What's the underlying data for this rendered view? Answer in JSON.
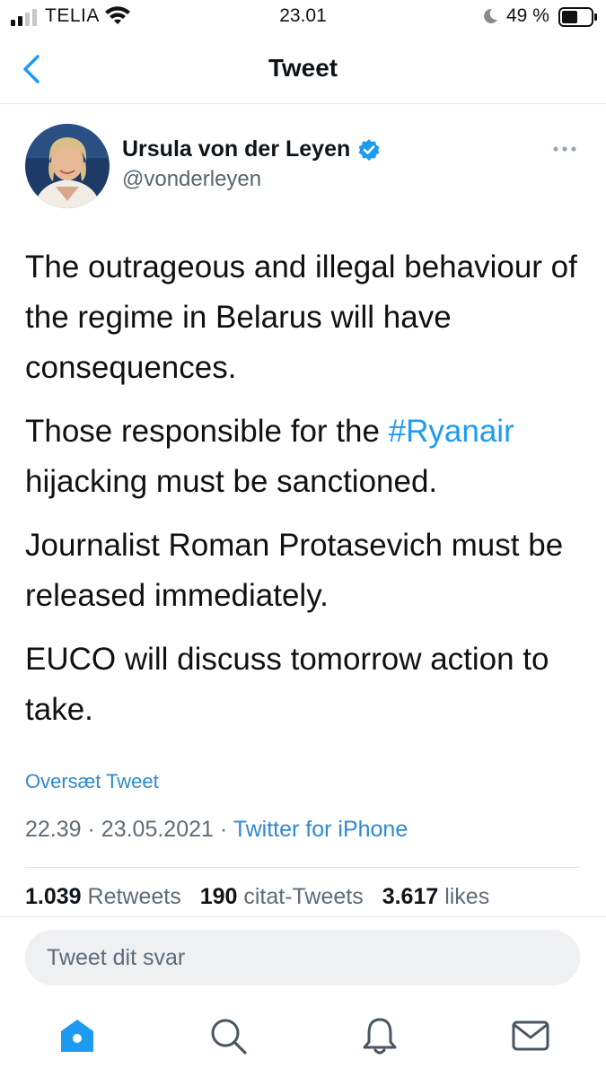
{
  "status_bar": {
    "carrier": "TELIA",
    "time": "23.01",
    "battery": "49 %",
    "icons": [
      "signal-icon",
      "wifi-icon",
      "moon-icon",
      "battery-icon"
    ]
  },
  "nav": {
    "title": "Tweet",
    "back_icon": "chevron-left-icon"
  },
  "tweet": {
    "author": {
      "name": "Ursula von der Leyen",
      "handle": "@vonderleyen",
      "verified": true
    },
    "paragraphs": [
      {
        "text": "The outrageous and illegal behaviour of the regime in Belarus will have consequences."
      },
      {
        "before": "Those responsible for the ",
        "hashtag": "#Ryanair",
        "after": " hijacking must be sanctioned."
      },
      {
        "text": "Journalist Roman Protasevich must be released immediately."
      },
      {
        "text": "EUCO will discuss tomorrow action to take."
      }
    ],
    "translate_label": "Oversæt Tweet",
    "time": "22.39",
    "date": "23.05.2021",
    "separator": "·",
    "source": "Twitter for iPhone",
    "stats": {
      "retweets_count": "1.039",
      "retweets_label": "Retweets",
      "quotes_count": "190",
      "quotes_label": "citat-Tweets",
      "likes_count": "3.617",
      "likes_label": "likes"
    }
  },
  "reply": {
    "placeholder": "Tweet dit svar"
  },
  "tabbar": {
    "items": [
      "home-icon",
      "search-icon",
      "notifications-icon",
      "messages-icon"
    ],
    "active": "home-icon"
  },
  "colors": {
    "accent": "#1d9bf0",
    "link": "#2f89d0",
    "secondary_text": "#5f6b77"
  }
}
